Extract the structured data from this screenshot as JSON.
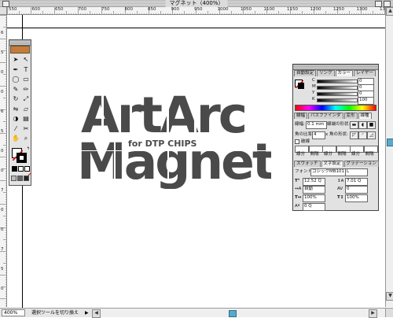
{
  "window": {
    "title": "マグネット（400%）",
    "status_zoom": "400%",
    "status_text": "選択ツールを切り換え"
  },
  "rulers": {
    "h_ticks": [
      "550",
      "600",
      "650",
      "700",
      "750",
      "800",
      "850",
      "900",
      "950",
      "1000",
      "1050",
      "1100",
      "1150",
      "1200",
      "1250",
      "1300",
      "1350"
    ],
    "v_ticks": [
      "6",
      "5",
      "0",
      "0",
      "6",
      "5",
      "0",
      "0",
      "7",
      "0",
      "0",
      "7",
      "5",
      "0"
    ]
  },
  "artwork": {
    "line1": "ArtArc",
    "line2": "Magnet",
    "tagline": "for DTP CHIPS",
    "color": "#4a4a4a"
  },
  "toolbox": {
    "tools": [
      "select-arrow",
      "direct-select",
      "pen",
      "text",
      "ellipse",
      "rectangle",
      "paintbrush",
      "pencil",
      "rotate",
      "scale",
      "reflect",
      "shear",
      "blend",
      "gradient",
      "eyedropper",
      "scissors",
      "hand",
      "zoom"
    ]
  },
  "panel": {
    "top_tabs": [
      "自動設定",
      "リンク",
      "カラー",
      "レイヤー"
    ],
    "active_top_tab": "カラー",
    "cmyk": [
      {
        "label": "C",
        "value": "0"
      },
      {
        "label": "M",
        "value": "0"
      },
      {
        "label": "Y",
        "value": "0"
      },
      {
        "label": "K",
        "value": "100"
      }
    ],
    "stroke_tabs": [
      "線幅",
      "パスファインダ",
      "変形",
      "線種"
    ],
    "stroke_weight_label": "線幅:",
    "stroke_weight": "0.1 mm",
    "cap_label": "線端の形状:",
    "miter_label": "角の比率:",
    "miter_value": "4",
    "join_label": "x 角の形状:",
    "dashed_label": "破線",
    "dash_labels": [
      "線分",
      "間隔",
      "線分",
      "間隔",
      "線分",
      "間隔"
    ],
    "char_tabs": [
      "スウォッチ",
      "文字設定",
      "グラデーション"
    ],
    "font_label": "フォント:",
    "font_value": "ゴシックMB101",
    "font_style": "L",
    "size_value": "12.52 Q",
    "leading_value": "7.01 Q",
    "tracking_value": "自動",
    "kerning_value": "0",
    "hscale_value": "100%",
    "vscale_value": "100%",
    "baseline_value": "0 Q"
  }
}
